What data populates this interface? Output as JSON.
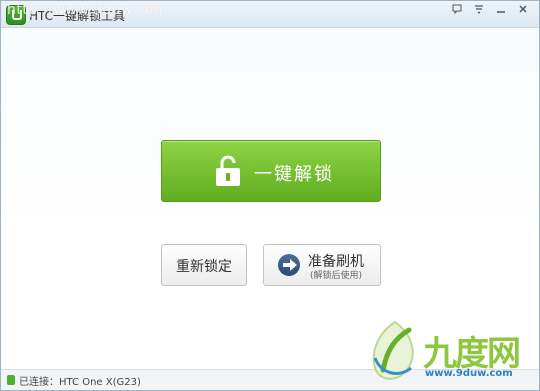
{
  "window": {
    "title": "HTC一键解锁工具",
    "watermark": "http://www.9duw.com"
  },
  "main": {
    "unlock_label": "一键解锁",
    "relock_label": "重新锁定",
    "prepare_label": "准备刷机",
    "prepare_sub": "(解锁后使用)"
  },
  "status": {
    "text": "已连接：HTC One X(G23)"
  },
  "logo": {
    "brand": "九度网",
    "url": "www.9duw.com"
  },
  "colors": {
    "accent_green": "#6fbf2a",
    "titlebar": "#dde8f0"
  }
}
